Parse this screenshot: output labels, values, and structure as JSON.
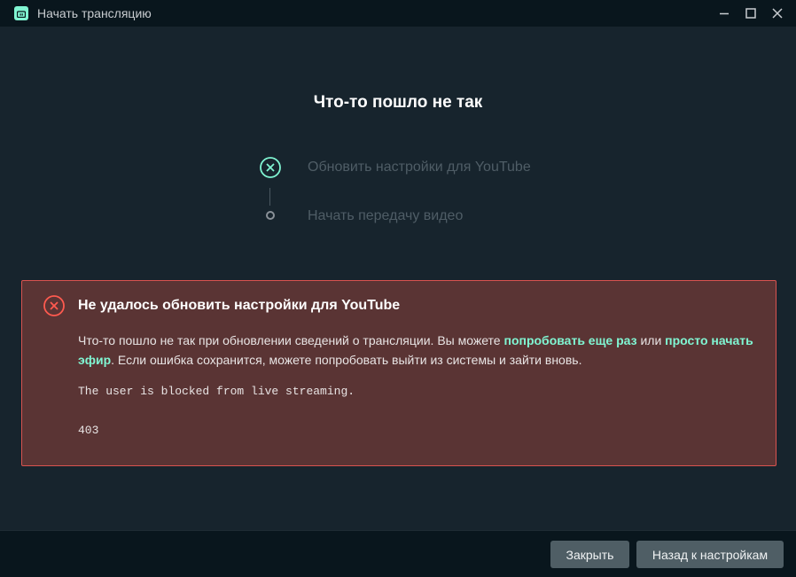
{
  "window": {
    "title": "Начать трансляцию",
    "icon": "streamlabs-logo-icon",
    "controls": [
      "minimize-icon",
      "maximize-icon",
      "close-icon"
    ]
  },
  "main": {
    "title": "Что-то пошло не так",
    "steps": [
      {
        "label": "Обновить настройки для YouTube",
        "status": "error"
      },
      {
        "label": "Начать передачу видео",
        "status": "pending"
      }
    ]
  },
  "error": {
    "title": "Не удалось обновить настройки для YouTube",
    "msg_part1": "Что-то пошло не так при обновлении сведений о трансляции. Вы можете ",
    "link_retry": "попробовать еще раз",
    "msg_part2": " или ",
    "link_start": "просто начать эфир",
    "msg_part3": ". Если ошибка сохранится, можете попробовать выйти из системы и зайти вновь.",
    "details": "The user is blocked from live streaming.",
    "code": "403"
  },
  "footer": {
    "close_label": "Закрыть",
    "back_label": "Назад к настройкам"
  },
  "colors": {
    "accent": "#80f5d2",
    "error_border": "#d9534f",
    "error_bg": "#5a3434",
    "background": "#17242d"
  }
}
